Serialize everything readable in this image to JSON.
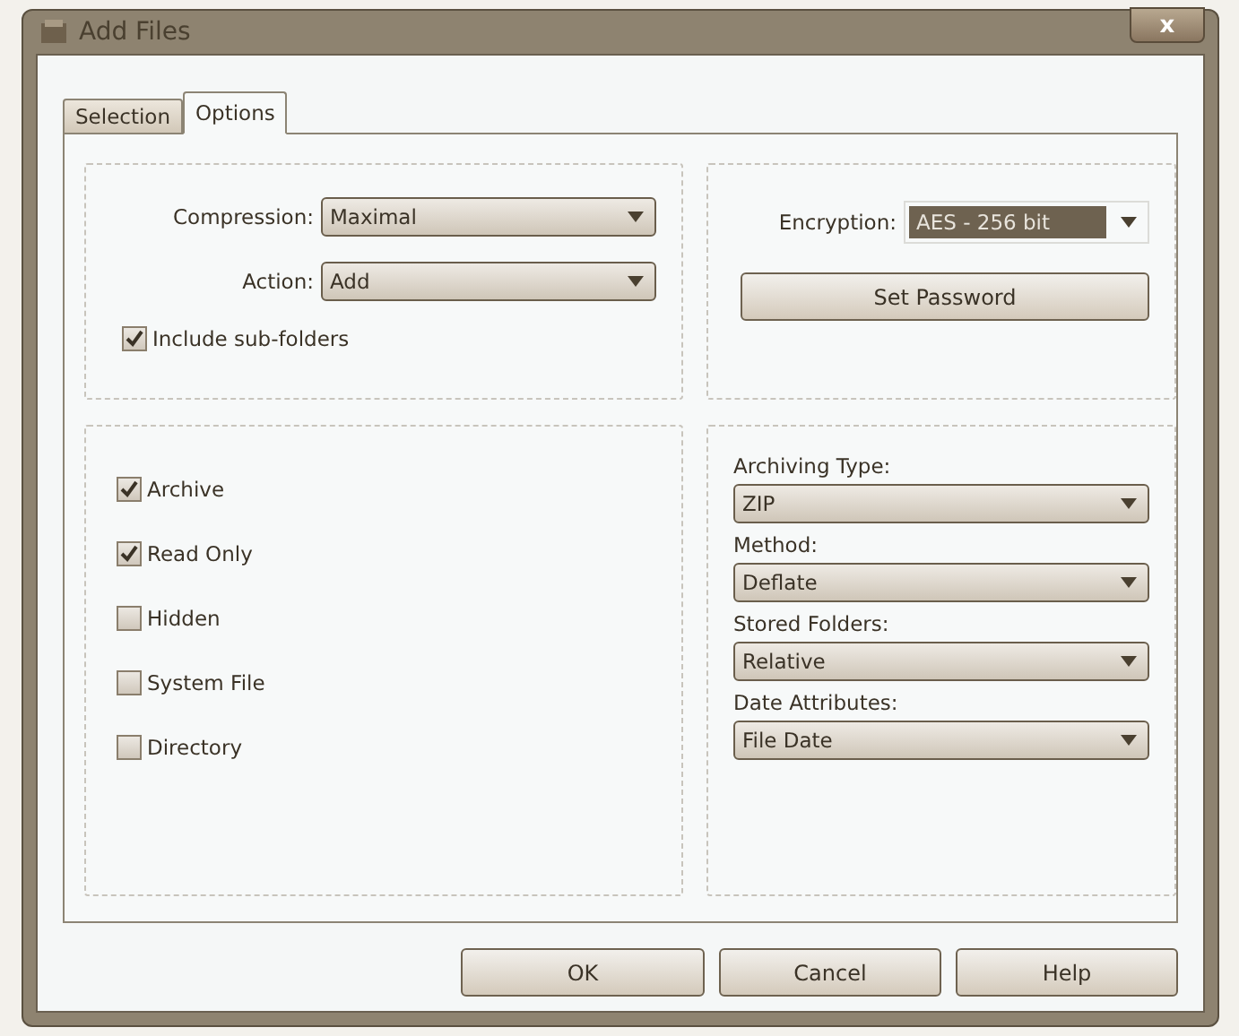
{
  "window": {
    "title": "Add Files",
    "close": "x"
  },
  "tabs": [
    {
      "label": "Selection",
      "selected": false
    },
    {
      "label": "Options",
      "selected": true
    }
  ],
  "compression": {
    "label": "Compression:",
    "value": "Maximal"
  },
  "action": {
    "label": "Action:",
    "value": "Add"
  },
  "include_subfolders": {
    "label": "Include sub-folders",
    "checked": true
  },
  "encryption": {
    "label": "Encryption:",
    "value": "AES - 256 bit"
  },
  "set_password": "Set Password",
  "attributes": [
    {
      "label": "Archive",
      "checked": true
    },
    {
      "label": "Read Only",
      "checked": true
    },
    {
      "label": "Hidden",
      "checked": false
    },
    {
      "label": "System File",
      "checked": false
    },
    {
      "label": "Directory",
      "checked": false
    }
  ],
  "archive_settings": [
    {
      "label": "Archiving Type:",
      "value": "ZIP"
    },
    {
      "label": "Method:",
      "value": "Deflate"
    },
    {
      "label": "Stored Folders:",
      "value": "Relative"
    },
    {
      "label": "Date Attributes:",
      "value": "File Date"
    }
  ],
  "buttons": [
    "OK",
    "Cancel",
    "Help"
  ]
}
